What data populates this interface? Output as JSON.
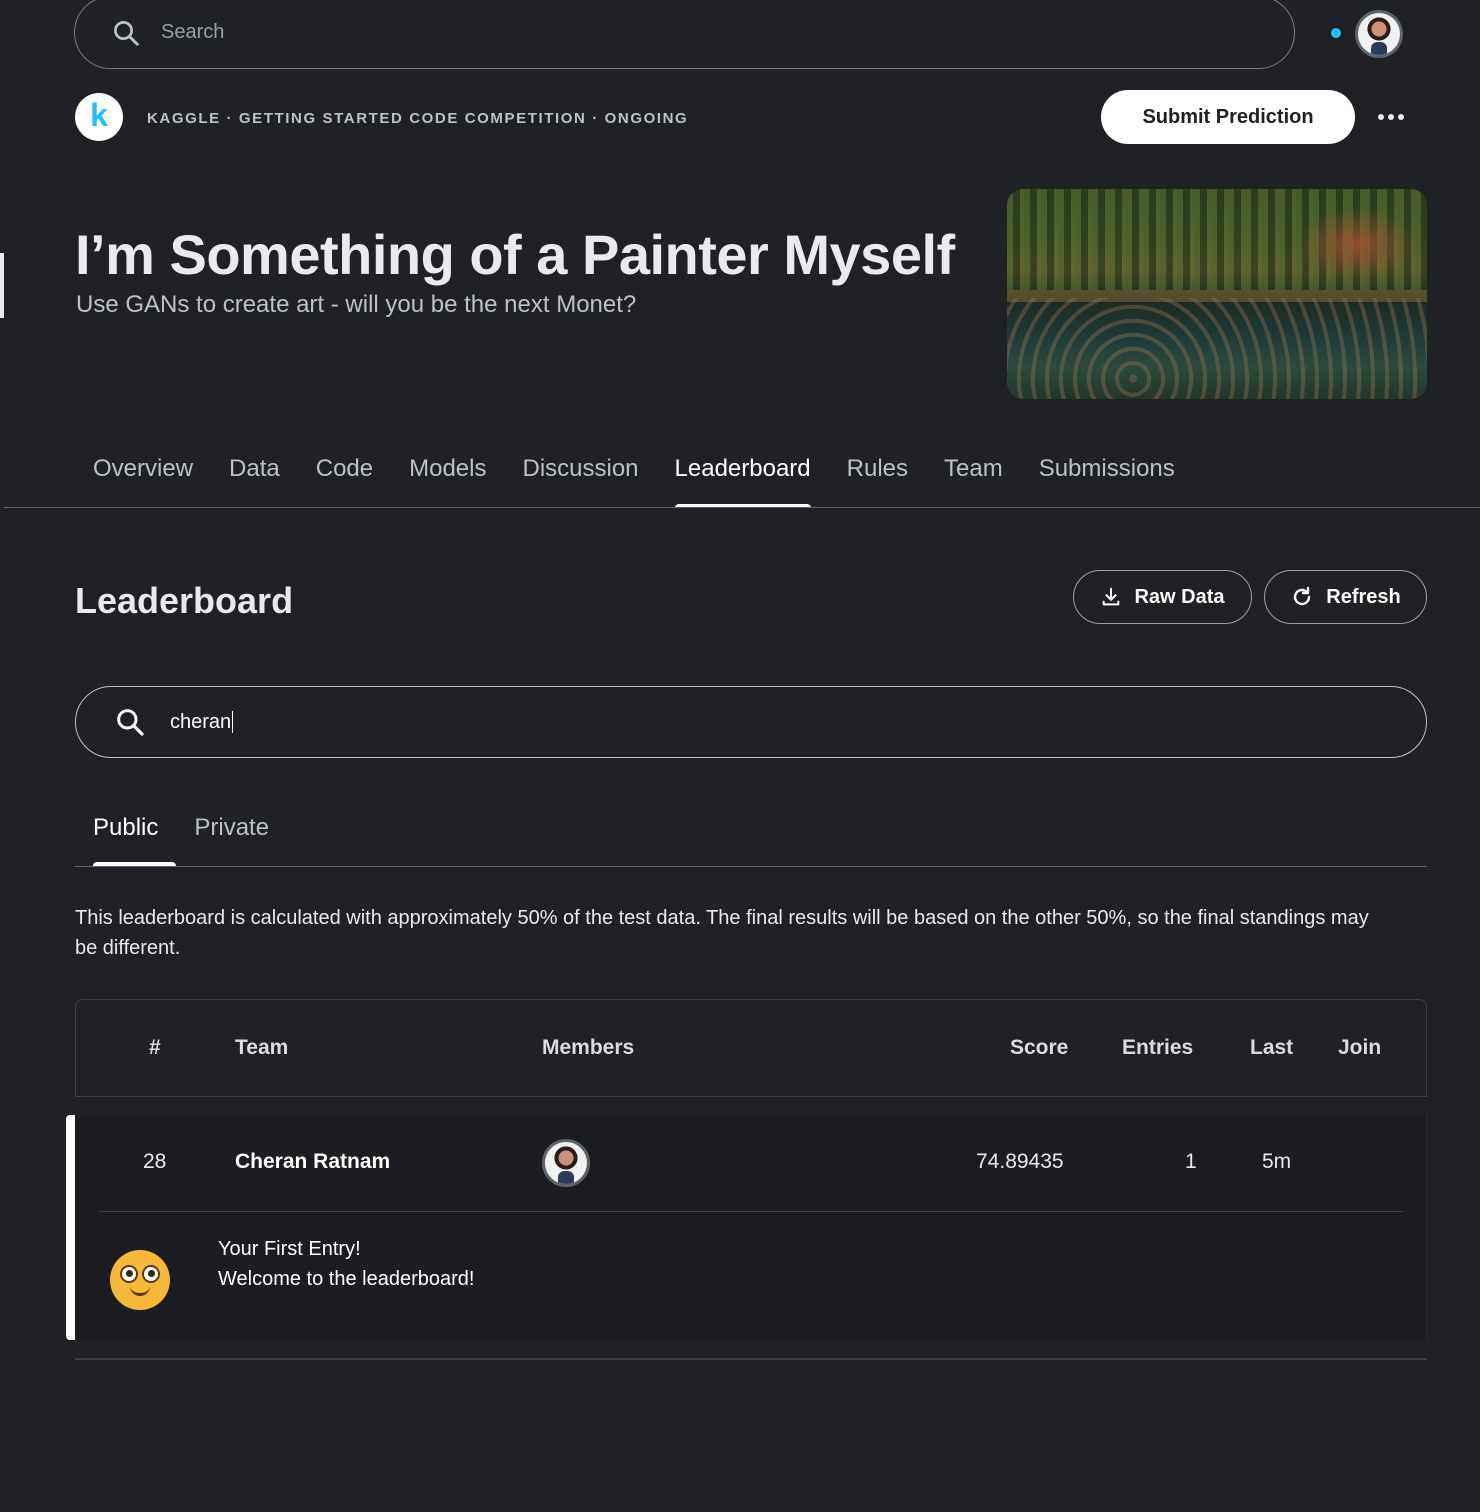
{
  "search": {
    "placeholder": "Search"
  },
  "competition": {
    "breadcrumb": "KAGGLE · GETTING STARTED CODE COMPETITION · ONGOING",
    "submit_label": "Submit Prediction",
    "title": "I’m Something of a Painter Myself",
    "subtitle": "Use GANs to create art - will you be the next Monet?"
  },
  "tabs": [
    {
      "label": "Overview"
    },
    {
      "label": "Data"
    },
    {
      "label": "Code"
    },
    {
      "label": "Models"
    },
    {
      "label": "Discussion"
    },
    {
      "label": "Leaderboard",
      "active": true
    },
    {
      "label": "Rules"
    },
    {
      "label": "Team"
    },
    {
      "label": "Submissions"
    }
  ],
  "leaderboard": {
    "title": "Leaderboard",
    "raw_data_label": "Raw Data",
    "refresh_label": "Refresh",
    "search_value": "cheran",
    "subtabs": [
      {
        "label": "Public",
        "active": true
      },
      {
        "label": "Private"
      }
    ],
    "note": "This leaderboard is calculated with approximately 50% of the test data. The final results will be based on the other 50%, so the final standings may be different.",
    "columns": {
      "rank": "#",
      "team": "Team",
      "members": "Members",
      "score": "Score",
      "entries": "Entries",
      "last": "Last",
      "join": "Join"
    },
    "rows": [
      {
        "rank": "28",
        "team": "Cheran Ratnam",
        "score": "74.89435",
        "entries": "1",
        "last": "5m",
        "message_title": "Your First Entry!",
        "message_body": "Welcome to the leaderboard!"
      }
    ]
  },
  "colors": {
    "background": "#202124",
    "accent": "#20beff",
    "text": "#e8eaed"
  }
}
